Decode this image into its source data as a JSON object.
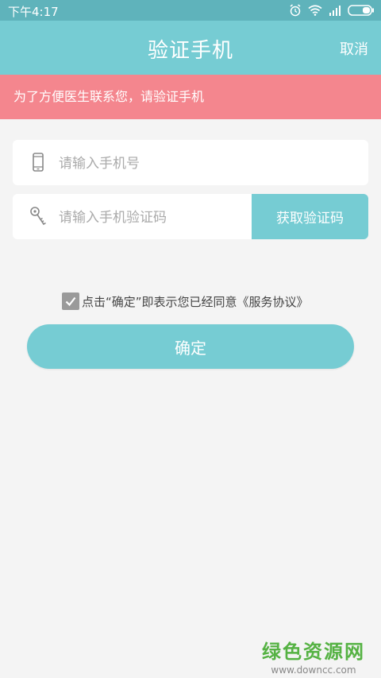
{
  "status_bar": {
    "time": "下午4:17"
  },
  "header": {
    "title": "验证手机",
    "cancel_label": "取消"
  },
  "notice": {
    "text": "为了方便医生联系您，请验证手机"
  },
  "form": {
    "phone_placeholder": "请输入手机号",
    "code_placeholder": "请输入手机验证码",
    "get_code_label": "获取验证码",
    "agreement_checked": true,
    "agreement_text": "点击“确定”即表示您已经同意《服务协议》",
    "confirm_label": "确定"
  },
  "watermark": {
    "title": "绿色资源网",
    "url": "www.downcc.com"
  },
  "colors": {
    "teal": "#76ccd3",
    "status_teal": "#5fb3bb",
    "notice_pink": "#f4868e",
    "background": "#f4f4f4"
  },
  "icons": [
    "alarm-icon",
    "wifi-icon",
    "signal-icon",
    "battery-icon",
    "phone-icon",
    "key-icon",
    "checkmark-icon"
  ]
}
